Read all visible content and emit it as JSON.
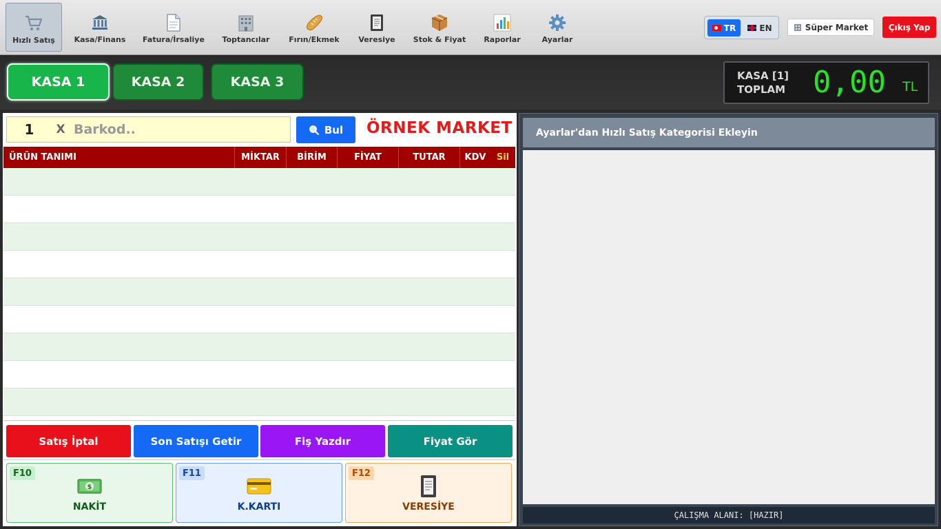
{
  "toolbar": {
    "items": [
      {
        "label": "Hızlı Satış",
        "icon": "shopping-cart-icon"
      },
      {
        "label": "Kasa/Finans",
        "icon": "bank-icon"
      },
      {
        "label": "Fatura/İrsaliye",
        "icon": "document-icon"
      },
      {
        "label": "Toptancılar",
        "icon": "building-icon"
      },
      {
        "label": "Fırın/Ekmek",
        "icon": "bread-icon"
      },
      {
        "label": "Veresiye",
        "icon": "notebook-icon"
      },
      {
        "label": "Stok & Fiyat",
        "icon": "package-icon"
      },
      {
        "label": "Raporlar",
        "icon": "bar-chart-icon"
      },
      {
        "label": "Ayarlar",
        "icon": "gear-icon"
      }
    ],
    "lang_tr": "TR",
    "lang_en": "EN",
    "store": "Süper Market",
    "exit": "Çıkış Yap"
  },
  "registers": {
    "tabs": [
      "KASA 1",
      "KASA 2",
      "KASA 3"
    ],
    "active": "KASA 1",
    "total_label_1": "KASA [1]",
    "total_label_2": "TOPLAM",
    "total_value": "0,00",
    "total_unit": "TL"
  },
  "sale": {
    "quantity": "1",
    "times": "X",
    "barcode_placeholder": "Barkod..",
    "find": "Bul",
    "market_name": "ÖRNEK MARKET",
    "columns": [
      "ÜRÜN TANIMI",
      "MİKTAR",
      "BİRİM",
      "FİYAT",
      "TUTAR",
      "KDV",
      "Sil"
    ],
    "rows": []
  },
  "actions": {
    "cancel": "Satış İptal",
    "last_sale": "Son Satışı Getir",
    "print": "Fiş Yazdır",
    "price_check": "Fiyat Gör"
  },
  "payments": {
    "cash": {
      "key": "F10",
      "label": "NAKİT",
      "icon": "money-icon"
    },
    "card": {
      "key": "F11",
      "label": "K.KARTI",
      "icon": "credit-card-icon"
    },
    "credit": {
      "key": "F12",
      "label": "VERESİYE",
      "icon": "notebook-icon"
    }
  },
  "quick_panel": {
    "header": "Ayarlar'dan Hızlı Satış Kategorisi Ekleyin",
    "status": "ÇALIŞMA ALANI: [HAZIR]"
  },
  "colors": {
    "accent_green": "#17b54a",
    "grid_header": "#a10000",
    "total_digits": "#27e227",
    "danger": "#e8111b",
    "primary": "#1469f5"
  }
}
